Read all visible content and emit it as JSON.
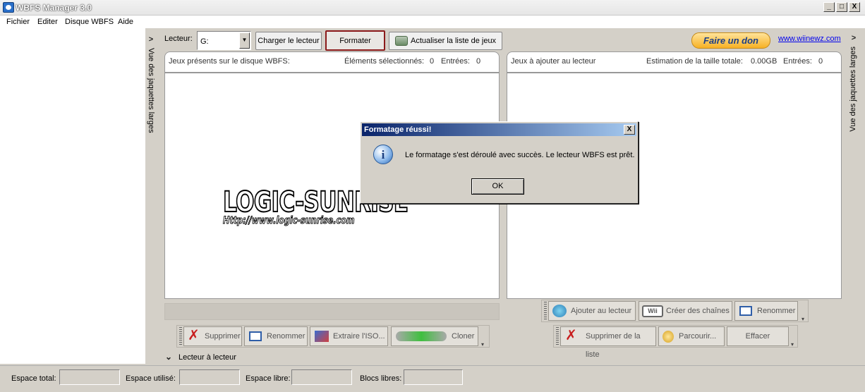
{
  "window": {
    "title": "WBFS Manager 3.0",
    "min": "_",
    "max": "□",
    "close": "X"
  },
  "menu": [
    "Fichier",
    "Editer",
    "Disque WBFS",
    "Aide"
  ],
  "left_rail": {
    "label": "Vue des jaquettes larges",
    "arrow": ">"
  },
  "right_rail": {
    "label": "Vue des jaquettes larges",
    "arrow": ">"
  },
  "toolbar": {
    "drive_label": "Lecteur:",
    "drive_value": "G:",
    "load_button": "Charger le lecteur",
    "format_button": "Formater",
    "refresh_button": "Actualiser la liste de jeux",
    "donate_button": "Faire un don",
    "site_link": "www.wiinewz.com"
  },
  "left_panel": {
    "title": "Jeux présents sur le disque WBFS:",
    "selected_label": "Éléments sélectionnés:",
    "selected_value": "0",
    "entries_label": "Entrées:",
    "entries_value": "0"
  },
  "right_panel": {
    "title": "Jeux à ajouter au lecteur",
    "size_label": "Estimation de la taille totale:",
    "size_value": "0.00GB",
    "entries_label": "Entrées:",
    "entries_value": "0"
  },
  "watermark": {
    "logo": "LOGIC-SUNRISE",
    "url": "Http://www.logic-sunrise.com"
  },
  "dialog": {
    "title": "Formatage réussi!",
    "message": "Le formatage s'est déroulé avec succès. Le lecteur WBFS est prêt.",
    "ok": "OK",
    "close": "X",
    "icon": "i"
  },
  "left_actions": {
    "delete": "Supprimer",
    "rename": "Renommer",
    "extract": "Extraire l'ISO...",
    "clone": "Cloner"
  },
  "right_actions_top": {
    "add": "Ajouter au lecteur",
    "channels": "Créer des chaînes",
    "rename": "Renommer"
  },
  "right_actions_bottom": {
    "remove": "Supprimer de la liste",
    "browse": "Parcourir...",
    "clear": "Effacer"
  },
  "drive_to_drive": {
    "arrow": "⌄",
    "label": "Lecteur à lecteur"
  },
  "status": {
    "total": "Espace total:",
    "used": "Espace utilisé:",
    "free": "Espace libre:",
    "blocks": "Blocs libres:"
  },
  "colors": {
    "dialog_title_start": "#0a246a",
    "dialog_title_end": "#a6caf0",
    "format_highlight": "#8b1a1a",
    "link": "#0000ee"
  }
}
